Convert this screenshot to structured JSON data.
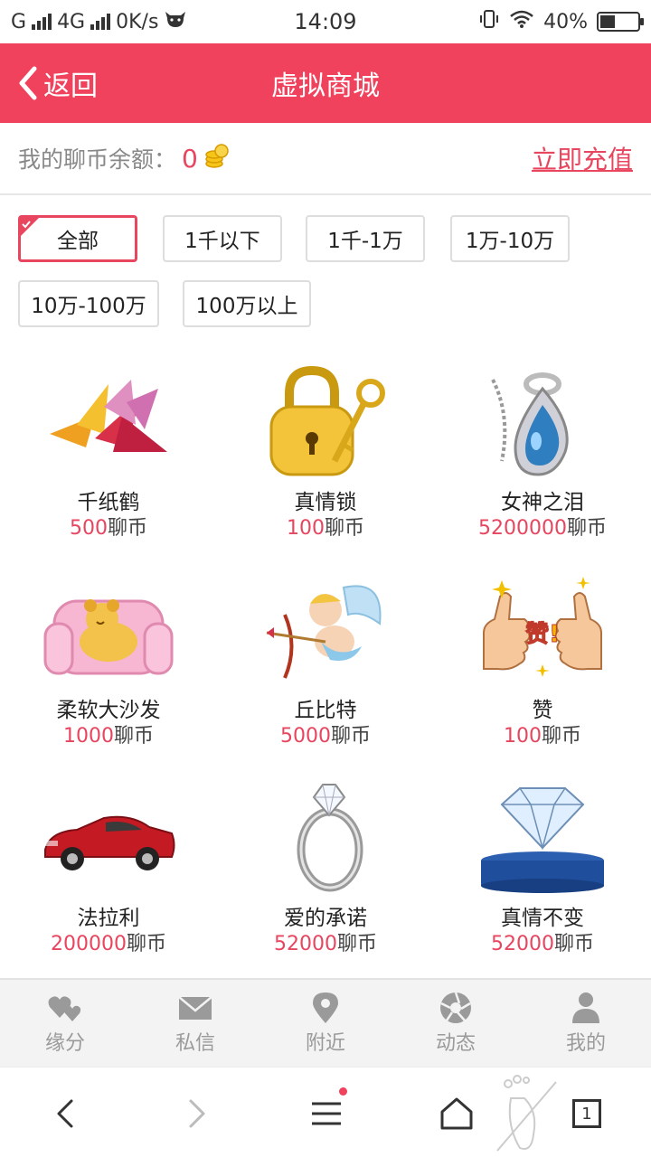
{
  "status_bar": {
    "carrier": "G",
    "network": "4G",
    "speed": "0K/s",
    "time": "14:09",
    "battery": "40%"
  },
  "header": {
    "back_label": "返回",
    "title": "虚拟商城"
  },
  "balance": {
    "label": "我的聊币余额：",
    "value": "0",
    "recharge_label": "立即充值"
  },
  "filters": [
    {
      "label": "全部",
      "active": true
    },
    {
      "label": "1千以下",
      "active": false
    },
    {
      "label": "1千-1万",
      "active": false
    },
    {
      "label": "1万-10万",
      "active": false
    },
    {
      "label": "10万-100万",
      "active": false
    },
    {
      "label": "100万以上",
      "active": false
    }
  ],
  "currency_unit": "聊币",
  "gifts": [
    {
      "name": "千纸鹤",
      "price": "500",
      "icon": "paper-crane-icon"
    },
    {
      "name": "真情锁",
      "price": "100",
      "icon": "lock-key-icon"
    },
    {
      "name": "女神之泪",
      "price": "5200000",
      "icon": "pendant-icon"
    },
    {
      "name": "柔软大沙发",
      "price": "1000",
      "icon": "bear-sofa-icon"
    },
    {
      "name": "丘比特",
      "price": "5000",
      "icon": "cupid-icon"
    },
    {
      "name": "赞",
      "price": "100",
      "icon": "thumbs-up-icon",
      "badge_text": "赞!"
    },
    {
      "name": "法拉利",
      "price": "200000",
      "icon": "car-icon"
    },
    {
      "name": "爱的承诺",
      "price": "52000",
      "icon": "ring-icon"
    },
    {
      "name": "真情不变",
      "price": "52000",
      "icon": "diamond-icon"
    }
  ],
  "tabbar": [
    {
      "label": "缘分",
      "icon": "hearts-icon"
    },
    {
      "label": "私信",
      "icon": "envelope-icon"
    },
    {
      "label": "附近",
      "icon": "location-pin-icon"
    },
    {
      "label": "动态",
      "icon": "aperture-icon"
    },
    {
      "label": "我的",
      "icon": "person-icon"
    }
  ],
  "browser_nav": {
    "tabs_count": "1"
  },
  "colors": {
    "brand": "#f0425c",
    "accent_text": "#e8455f",
    "muted": "#9a9a9a"
  }
}
